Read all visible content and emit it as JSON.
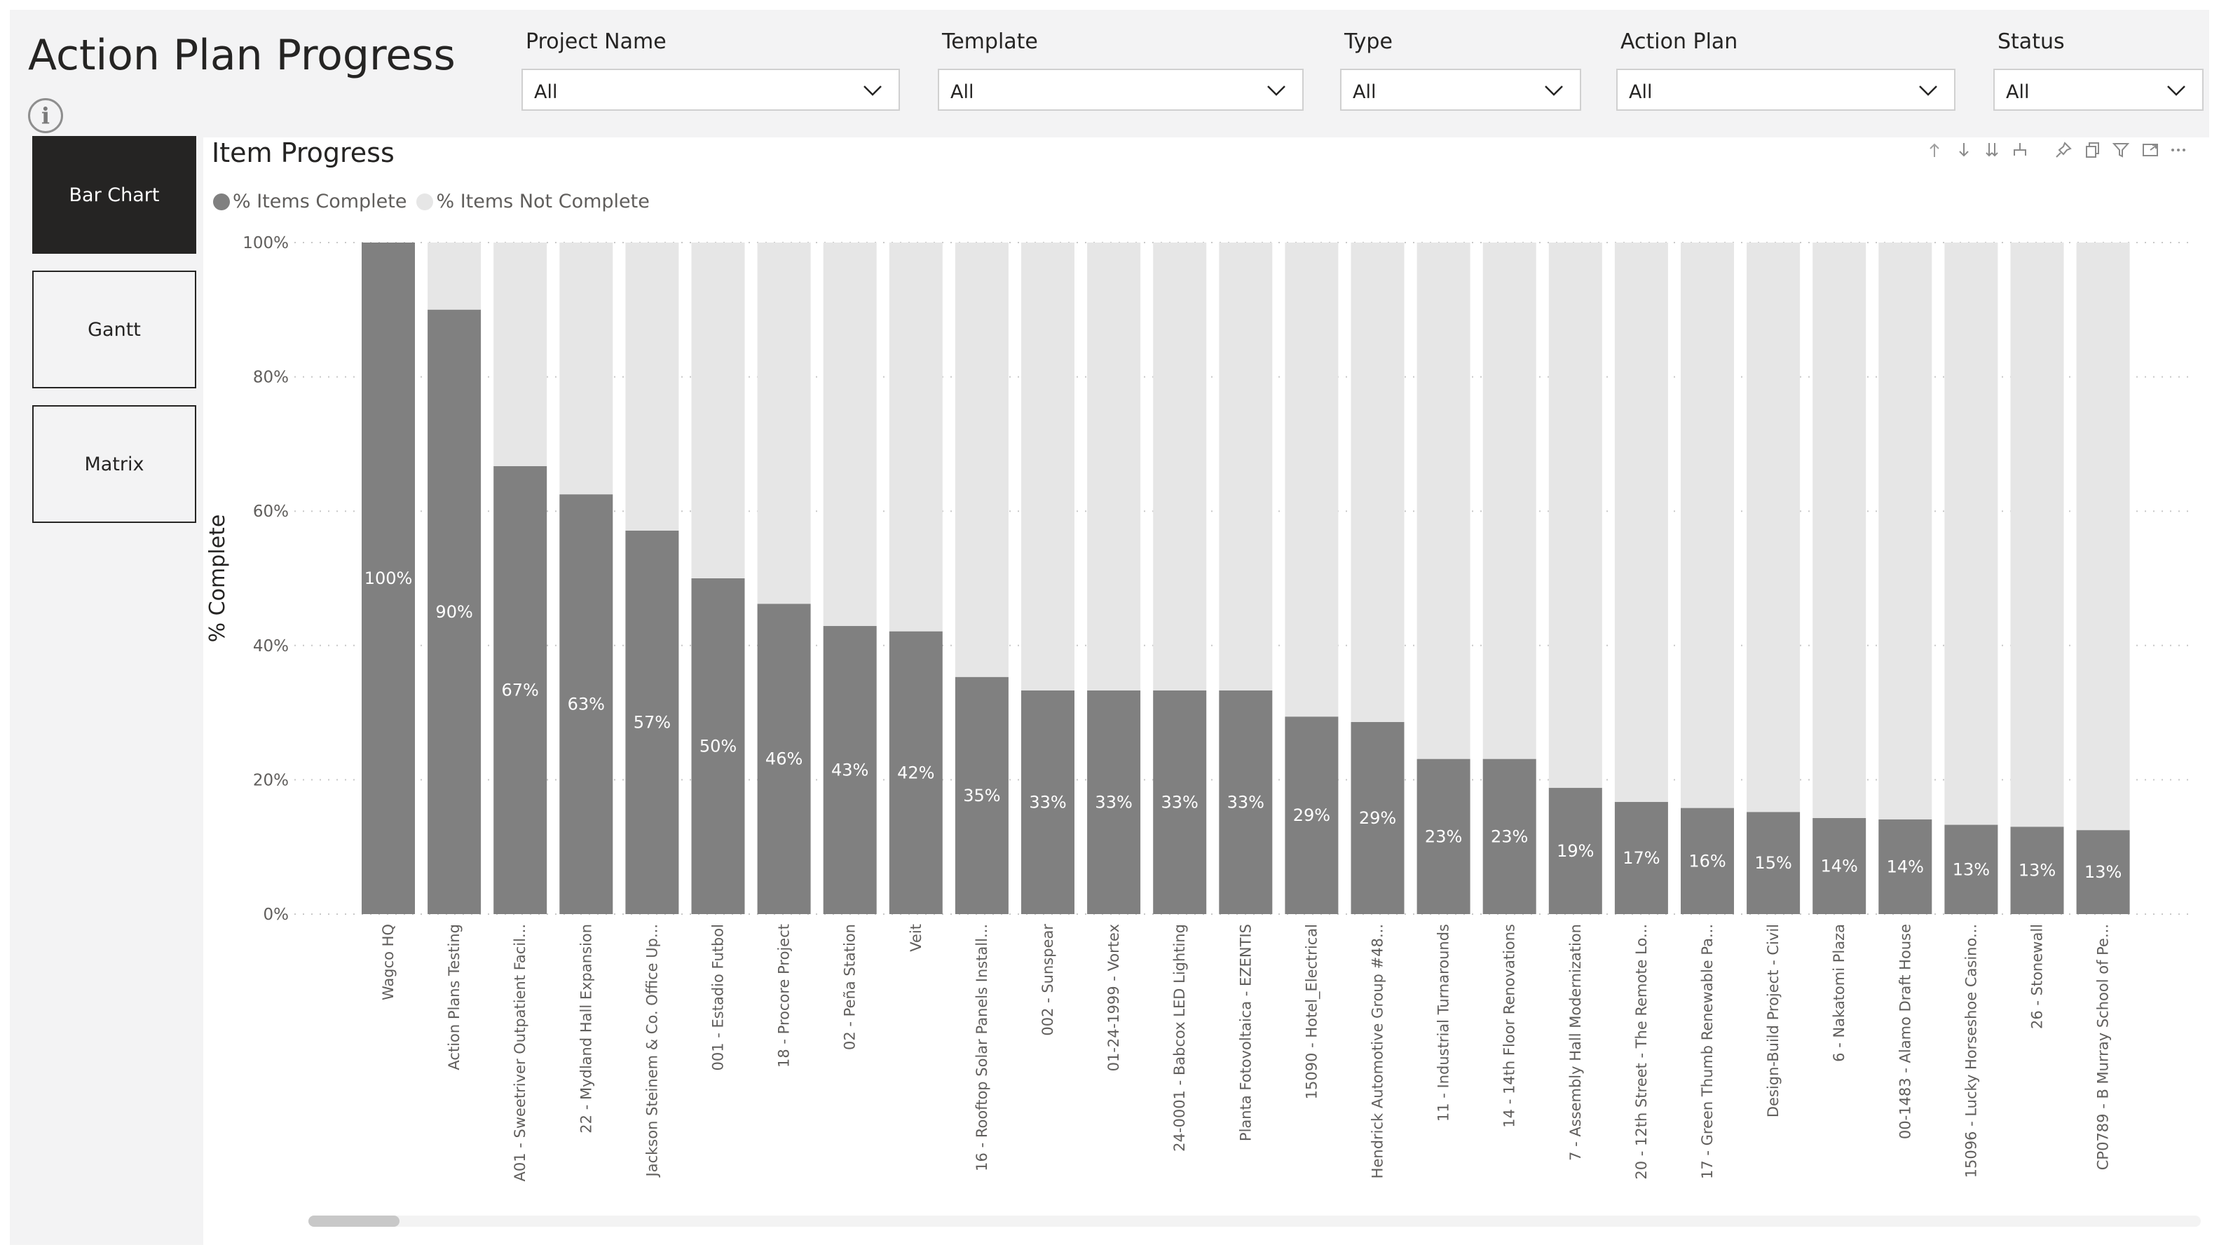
{
  "page": {
    "title": "Action Plan Progress"
  },
  "filters": [
    {
      "label": "Project Name",
      "value": "All"
    },
    {
      "label": "Template",
      "value": "All"
    },
    {
      "label": "Type",
      "value": "All"
    },
    {
      "label": "Action Plan",
      "value": "All"
    },
    {
      "label": "Status",
      "value": "All"
    }
  ],
  "nav": {
    "bar_chart": "Bar Chart",
    "gantt": "Gantt",
    "matrix": "Matrix",
    "active": "bar_chart"
  },
  "visual": {
    "title": "Item Progress",
    "toolbar_icons": [
      "drill-up-icon",
      "drill-down-icon",
      "expand-all-down-icon",
      "expand-hierarchy-icon",
      "pin-icon",
      "copy-visual-icon",
      "filter-icon",
      "focus-mode-icon",
      "more-options-icon"
    ],
    "scroll_position": 0.0
  },
  "chart_data": {
    "type": "bar",
    "stacked": "100%",
    "title": "Item Progress",
    "xlabel": "",
    "ylabel": "% Complete",
    "ylim": [
      0,
      100
    ],
    "yticks": [
      "0%",
      "20%",
      "40%",
      "60%",
      "80%",
      "100%"
    ],
    "grid": "horizontal-dotted",
    "legend_position": "top-left",
    "categories": [
      "Wagco HQ",
      "Action Plans Testing",
      "A01 - Sweetriver Outpatient Facil...",
      "22 - Mydland Hall Expansion",
      "Jackson Steinem & Co. Office Up...",
      "001 - Estadio Futbol",
      "18 - Procore Project",
      "02 - Peña Station",
      "Veit",
      "16 - Rooftop Solar Panels Install...",
      "002 - Sunspear",
      "01-24-1999 - Vortex",
      "24-0001 - Babcox LED Lighting",
      "Planta Fotovoltaica - EZENTIS",
      "15090 - Hotel_Electrical",
      "Hendrick Automotive Group #48...",
      "11 - Industrial Turnarounds",
      "14 - 14th Floor Renovations",
      "7 - Assembly Hall Modernization",
      "20 - 12th Street - The Remote Lo...",
      "17 - Green Thumb Renewable Pa...",
      "Design-Build Project - Civil",
      "6 - Nakatomi Plaza",
      "00-1483 - Alamo Draft House",
      "15096 - Lucky Horseshoe Casino...",
      "26 - Stonewall",
      "CP0789 - B Murray School of Pe..."
    ],
    "series": [
      {
        "name": "% Items Complete",
        "color": "#808080",
        "values": [
          100,
          90,
          66.7,
          62.5,
          57.1,
          50,
          46.2,
          42.9,
          42.1,
          35.3,
          33.3,
          33.3,
          33.3,
          33.3,
          29.4,
          28.6,
          23.1,
          23.1,
          18.8,
          16.7,
          15.8,
          15.2,
          14.3,
          14.1,
          13.3,
          13.0,
          12.5
        ]
      },
      {
        "name": "% Items Not Complete",
        "color": "#e6e6e6",
        "values": [
          0,
          10,
          33.3,
          37.5,
          42.9,
          50,
          53.8,
          57.1,
          57.9,
          64.7,
          66.7,
          66.7,
          66.7,
          66.7,
          70.6,
          71.4,
          76.9,
          76.9,
          81.2,
          83.3,
          84.2,
          84.8,
          85.7,
          85.9,
          86.7,
          87.0,
          87.5
        ]
      }
    ],
    "data_labels": [
      "100%",
      "90%",
      "67%",
      "63%",
      "57%",
      "50%",
      "46%",
      "43%",
      "42%",
      "35%",
      "33%",
      "33%",
      "33%",
      "33%",
      "29%",
      "29%",
      "23%",
      "23%",
      "19%",
      "17%",
      "16%",
      "15%",
      "14%",
      "14%",
      "13%",
      "13%",
      "13%"
    ]
  }
}
